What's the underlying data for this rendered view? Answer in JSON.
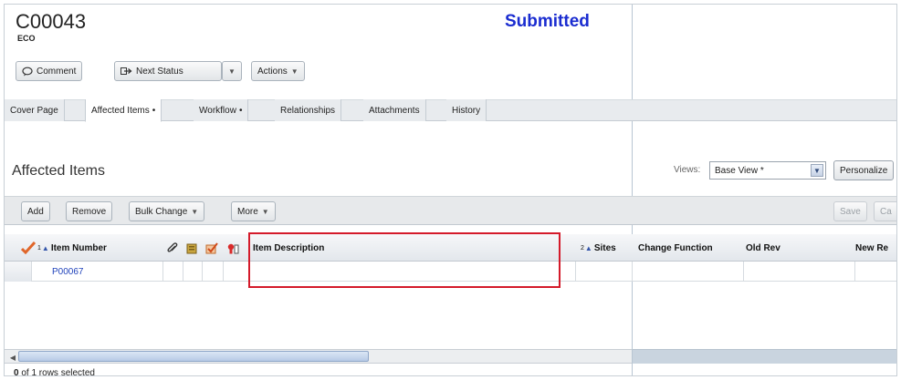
{
  "header": {
    "number": "C00043",
    "type": "ECO",
    "status": "Submitted"
  },
  "actions": {
    "comment_label": "Comment",
    "next_status_label": "Next Status",
    "actions_label": "Actions"
  },
  "tabs": [
    {
      "label": "Cover Page",
      "modified": ""
    },
    {
      "label": "Affected Items",
      "modified": "•"
    },
    {
      "label": "Workflow",
      "modified": "•"
    },
    {
      "label": "Relationships",
      "modified": ""
    },
    {
      "label": "Attachments",
      "modified": ""
    },
    {
      "label": "History",
      "modified": ""
    }
  ],
  "section": {
    "title": "Affected Items"
  },
  "views": {
    "label": "Views:",
    "selected": "Base View *",
    "personalize_label": "Personalize"
  },
  "toolbar": {
    "add_label": "Add",
    "remove_label": "Remove",
    "bulk_change_label": "Bulk Change",
    "more_label": "More",
    "save_label": "Save",
    "cancel_label": "Ca"
  },
  "grid": {
    "columns": {
      "item_number": "Item Number",
      "item_number_sort": "1",
      "item_description": "Item Description",
      "sites": "Sites",
      "sites_sort": "2",
      "change_function": "Change Function",
      "old_rev": "Old Rev",
      "new_rev": "New Re"
    },
    "rows": [
      {
        "item_number": "P00067",
        "item_description": ""
      }
    ]
  },
  "status_bar": {
    "selected_count": "0",
    "text": " of 1 rows selected"
  }
}
